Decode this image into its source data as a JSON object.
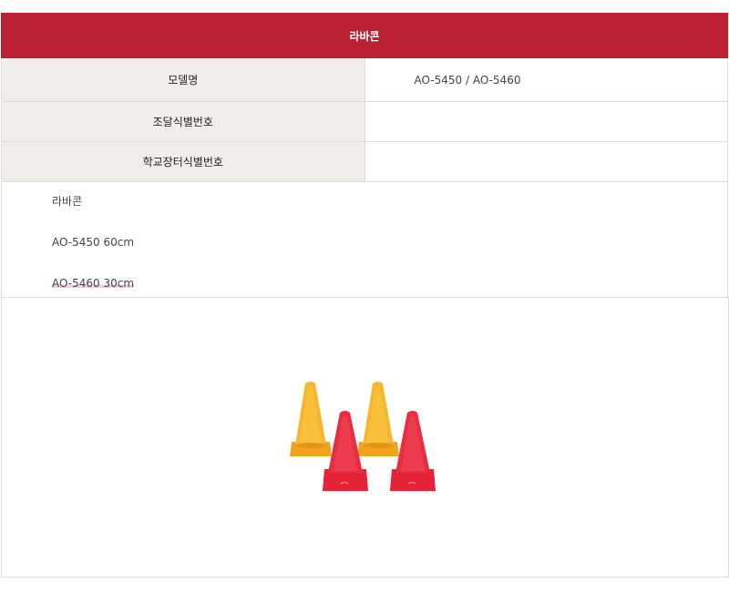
{
  "table": {
    "title": "라바콘",
    "rows": [
      {
        "label": "모델명",
        "value": "AO-5450 / AO-5460"
      },
      {
        "label": "조달식별번호",
        "value": ""
      },
      {
        "label": "학교장터식별번호",
        "value": ""
      }
    ]
  },
  "description": {
    "lines": [
      "라바콘",
      "AO-5450  60cm",
      "AO-5460  30cm"
    ]
  },
  "colors": {
    "header_bg": "#bd1f33",
    "label_bg": "#f1eee9",
    "cone_yellow": "#f7b52a",
    "cone_red": "#ea2c40"
  }
}
